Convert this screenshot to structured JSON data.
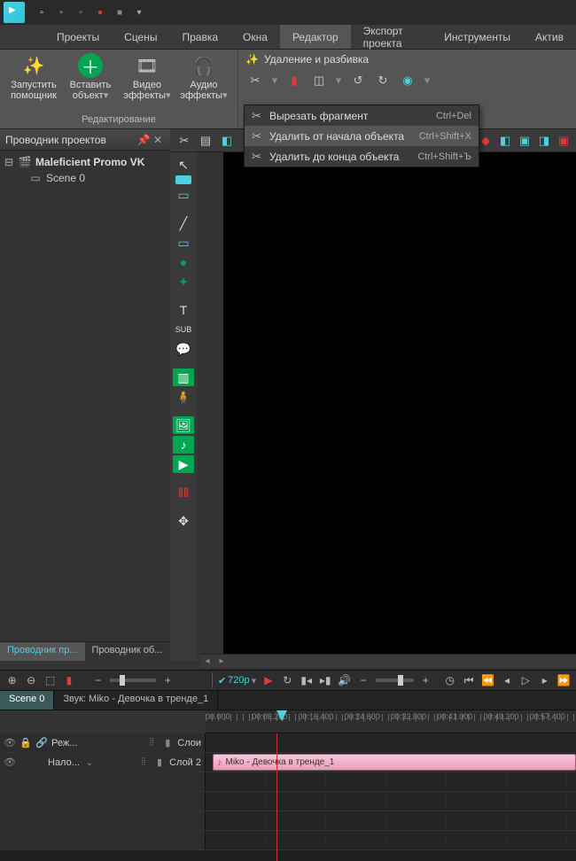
{
  "menubar": {
    "items": [
      "Проекты",
      "Сцены",
      "Правка",
      "Окна",
      "Редактор",
      "Экспорт проекта",
      "Инструменты",
      "Актив"
    ],
    "active_index": 4
  },
  "ribbon": {
    "group1_label": "Редактирование",
    "btn_wizard": "Запустить\nпомощник",
    "btn_insert": "Вставить\nобъект",
    "btn_video": "Видео\nэффекты",
    "btn_audio": "Аудио\nэффекты",
    "split_title": "Удаление и разбивка"
  },
  "dropdown": {
    "items": [
      {
        "label": "Вырезать фрагмент",
        "shortcut": "Ctrl+Del"
      },
      {
        "label": "Удалить от начала объекта",
        "shortcut": "Ctrl+Shift+X"
      },
      {
        "label": "Удалить до конца объекта",
        "shortcut": "Ctrl+Shift+Ъ"
      }
    ],
    "hover_index": 1
  },
  "explorer": {
    "title": "Проводник проектов",
    "project": "Maleficient Promo VK",
    "scene": "Scene 0",
    "tabs": [
      "Проводник пр...",
      "Проводник об..."
    ],
    "active_tab": 0
  },
  "controlbar": {
    "resolution": "720p"
  },
  "timeline": {
    "tabs": [
      "Scene 0",
      "Звук: Miko - Девочка в тренде_1"
    ],
    "active_tab": 0,
    "ruler_ticks": [
      "00.000",
      "00:08.200",
      "00:16.400",
      "00:24.600",
      "00:32.800",
      "00:41.000",
      "00:49.200",
      "00:57.400"
    ],
    "track1_label": "Реж...",
    "track1_group": "Слои",
    "track2_label": "Нало...",
    "track2_sub": "Слой 2",
    "clip_name": "Miko - Девочка в тренде_1"
  }
}
